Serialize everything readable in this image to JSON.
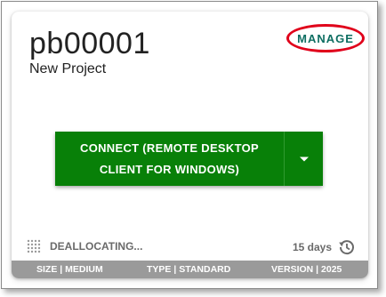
{
  "project": {
    "id": "pb00001",
    "name": "New Project"
  },
  "manage_label": "MANAGE",
  "connect": {
    "label": "CONNECT (REMOTE DESKTOP CLIENT FOR WINDOWS)"
  },
  "status": {
    "state": "DEALLOCATING...",
    "days": "15 days"
  },
  "footer": {
    "size": "SIZE | MEDIUM",
    "type": "TYPE | STANDARD",
    "version": "VERSION | 2025"
  },
  "colors": {
    "primary_button": "#088008",
    "manage_text": "#0e6e62",
    "highlight_ellipse": "#e0001a",
    "footer_bg": "#9a9a9a"
  },
  "icons": {
    "dropdown": "caret-down-icon",
    "status": "dot-grid-icon",
    "days": "history-icon"
  }
}
